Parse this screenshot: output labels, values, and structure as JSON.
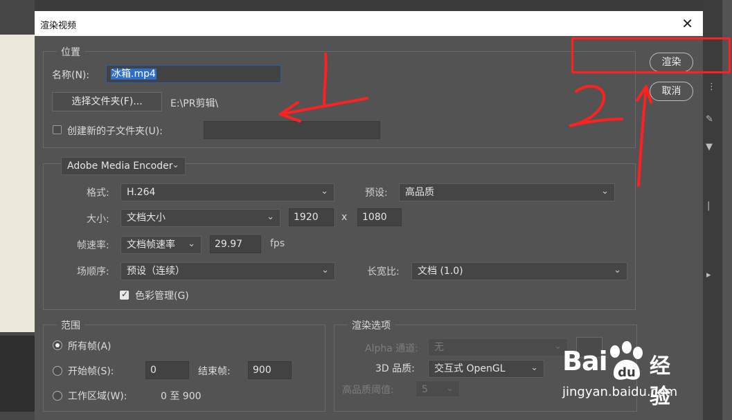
{
  "dialog": {
    "title": "渲染视频",
    "render_label": "渲染",
    "cancel_label": "取消"
  },
  "location": {
    "legend": "位置",
    "name_label": "名称(N):",
    "name_value": "冰箱.mp4",
    "folder_button": "选择文件夹(F)...",
    "folder_path": "E:\\PR剪辑\\",
    "subfolder_label": "创建新的子文件夹(U):",
    "subfolder_value": "",
    "subfolder_checked": false
  },
  "encoder": {
    "selector": "Adobe Media Encoder",
    "format_label": "格式:",
    "format_value": "H.264",
    "preset_label": "预设:",
    "preset_value": "高品质",
    "size_label": "大小:",
    "size_value": "文档大小",
    "width": "1920",
    "x_label": "x",
    "height": "1080",
    "framerate_label": "帧速率:",
    "framerate_mode": "文档帧速率",
    "framerate_value": "29.97",
    "fps_label": "fps",
    "field_order_label": "场顺序:",
    "field_order_value": "预设（连续）",
    "aspect_label": "长宽比:",
    "aspect_value": "文档 (1.0)",
    "color_mgmt_label": "色彩管理(G)",
    "color_mgmt_checked": true
  },
  "range": {
    "legend": "范围",
    "all_frames": "所有帧(A)",
    "start_frame_label": "开始帧(S):",
    "start_frame_value": "0",
    "end_frame_label": "结束帧:",
    "end_frame_value": "900",
    "work_area_label": "工作区域(W):",
    "work_area_value": "0 至 900",
    "selected": "all_frames"
  },
  "render_options": {
    "legend": "渲染选项",
    "alpha_label": "Alpha 通道:",
    "alpha_value": "无",
    "quality_3d_label": "3D 品质:",
    "quality_3d_value": "交互式 OpenGL",
    "hq_threshold_label": "高品质阈值:",
    "hq_threshold_value": "5"
  },
  "watermark": {
    "brand": "Bai",
    "suffix": "经验",
    "url": "jingyan.baidu.com"
  },
  "icons": [
    "close-icon",
    "chevron-down-icon",
    "checkbox-icon",
    "radio-icon",
    "paw-icon"
  ],
  "colors": {
    "annotation": "#ff2020",
    "selection": "#2d6ec9",
    "dialog_bg": "#535353"
  }
}
